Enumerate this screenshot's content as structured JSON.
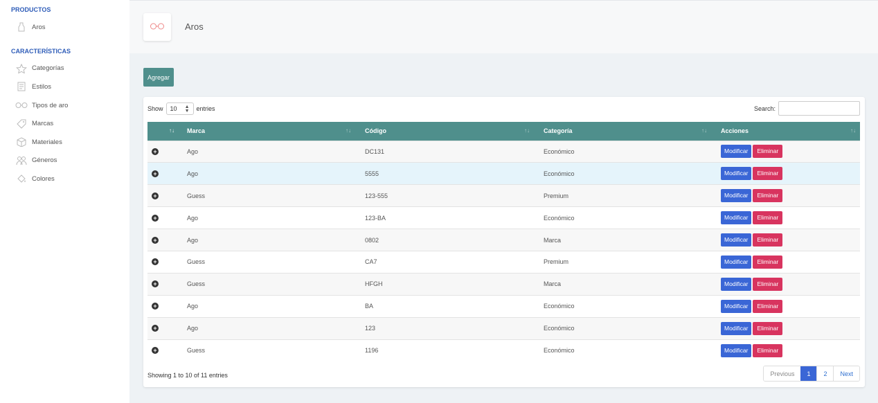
{
  "sidebar": {
    "section1": "PRODUCTOS",
    "section1_items": [
      {
        "label": "Aros",
        "icon": "glasses-bottle-icon"
      }
    ],
    "section2": "CARACTERÍSTICAS",
    "section2_items": [
      {
        "label": "Categorías",
        "icon": "star-icon"
      },
      {
        "label": "Estilos",
        "icon": "document-icon"
      },
      {
        "label": "Tipos de aro",
        "icon": "glasses-icon"
      },
      {
        "label": "Marcas",
        "icon": "tag-icon"
      },
      {
        "label": "Materiales",
        "icon": "box-icon"
      },
      {
        "label": "Géneros",
        "icon": "users-icon"
      },
      {
        "label": "Colores",
        "icon": "paint-bucket-icon"
      }
    ]
  },
  "header": {
    "title": "Aros",
    "logo_icon": "glasses-icon"
  },
  "toolbar": {
    "add_label": "Agregar"
  },
  "table_controls": {
    "show_label": "Show",
    "entries_value": "10",
    "entries_label": "entries",
    "search_label": "Search:"
  },
  "table": {
    "columns": [
      "Marca",
      "Código",
      "Categoría",
      "Acciones"
    ],
    "rows": [
      {
        "marca": "Ago",
        "codigo": "DC131",
        "categoria": "Económico"
      },
      {
        "marca": "Ago",
        "codigo": "5555",
        "categoria": "Económico"
      },
      {
        "marca": "Guess",
        "codigo": "123-555",
        "categoria": "Premium"
      },
      {
        "marca": "Ago",
        "codigo": "123-BA",
        "categoria": "Económico"
      },
      {
        "marca": "Ago",
        "codigo": "0802",
        "categoria": "Marca"
      },
      {
        "marca": "Guess",
        "codigo": "CA7",
        "categoria": "Premium"
      },
      {
        "marca": "Guess",
        "codigo": "HFGH",
        "categoria": "Marca"
      },
      {
        "marca": "Ago",
        "codigo": "BA",
        "categoria": "Económico"
      },
      {
        "marca": "Ago",
        "codigo": "123",
        "categoria": "Económico"
      },
      {
        "marca": "Guess",
        "codigo": "1196",
        "categoria": "Económico"
      }
    ],
    "modify_label": "Modificar",
    "delete_label": "Eliminar"
  },
  "footer": {
    "info": "Showing 1 to 10 of 11 entries",
    "previous": "Previous",
    "pages": [
      "1",
      "2"
    ],
    "next": "Next"
  },
  "colors": {
    "accent_teal": "#4f8f8c",
    "primary_blue": "#3a66d6",
    "danger_red": "#d8345f",
    "section_blue": "#2e5cb8"
  }
}
